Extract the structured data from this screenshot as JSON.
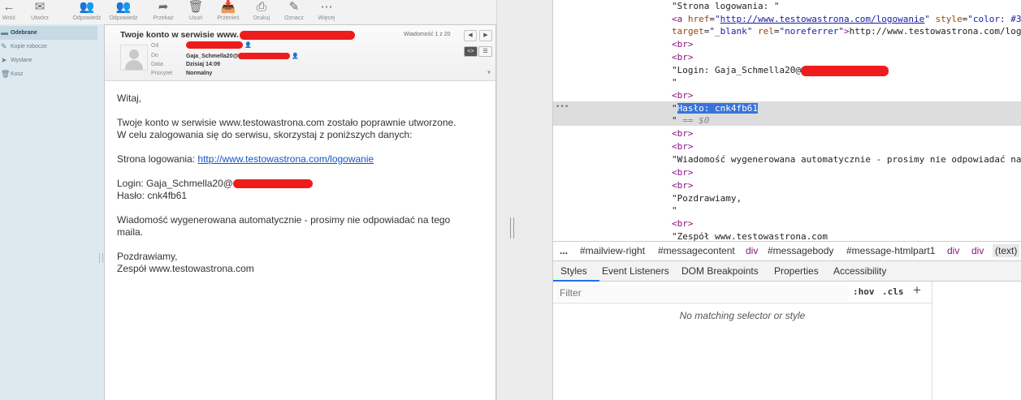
{
  "toolbar": {
    "buttons": [
      {
        "label": "Wróć",
        "icon": "back-arrow-icon"
      },
      {
        "label": "Utwórz",
        "icon": "compose-icon"
      },
      {
        "label": "Odpowiedz",
        "icon": "reply-icon"
      },
      {
        "label": "Odpowiedz",
        "icon": "reply-all-icon"
      },
      {
        "label": "Przekaż",
        "icon": "forward-icon"
      },
      {
        "label": "Usuń",
        "icon": "delete-icon"
      },
      {
        "label": "Przenieś",
        "icon": "move-icon"
      },
      {
        "label": "Drukuj",
        "icon": "print-icon"
      },
      {
        "label": "Oznacz",
        "icon": "mark-icon"
      },
      {
        "label": "Więcej",
        "icon": "more-icon"
      }
    ]
  },
  "folders": [
    {
      "label": "Odebrane",
      "active": true
    },
    {
      "label": "Kopie robocze",
      "active": false
    },
    {
      "label": "Wysłane",
      "active": false
    },
    {
      "label": "Kosz",
      "active": false
    }
  ],
  "message": {
    "subject": "Twoje konto w serwisie www.",
    "counter": "Wiadomość 1 z 20",
    "headers": {
      "from_label": "Od",
      "to_label": "Do",
      "to_value": "Gaja_Schmella20@",
      "date_label": "Data",
      "date_value": "Dzisiaj 14:09",
      "priority_label": "Priorytet",
      "priority_value": "Normalny"
    },
    "body": {
      "greeting": "Witaj,",
      "line1": "Twoje konto w serwisie www.testowastrona.com zostało poprawnie utworzone.",
      "line2": "W celu zalogowania się do serwisu, skorzystaj z poniższych danych:",
      "login_page_label": "Strona logowania:",
      "login_page_url": "http://www.testowastrona.com/logowanie",
      "login_label": "Login: Gaja_Schmella20@",
      "password_line": "Hasło: cnk4fb61",
      "auto_line1": "Wiadomość wygenerowana automatycznie - prosimy nie odpowiadać na tego",
      "auto_line2": "maila.",
      "regards": "Pozdrawiamy,",
      "team": "Zespół www.testowastrona.com"
    }
  },
  "devtools": {
    "dom": {
      "line_strona": "\"Strona logowania: \"",
      "a_open": "<a",
      "a_href_attr": "href",
      "a_href_val": "http://www.testowastrona.com/logowanie",
      "a_style_attr": "style",
      "a_style_val": "\"color: #3",
      "a_target_attr": "target",
      "a_target_val": "\"_blank\"",
      "a_rel_attr": "rel",
      "a_rel_val": "\"noreferrer\"",
      "a_text": "http://www.testowastrona.com/log",
      "br": "<br>",
      "login_text": "\"Login: Gaja_Schmella20@",
      "quote": "\"",
      "selected_text": "Hasło: cnk4fb61",
      "eq_dollar": "== $0",
      "auto_text": "\"Wiadomość wygenerowana automatycznie - prosimy nie odpowiadać na",
      "regards_text": "\"Pozdrawiamy,",
      "team_text": "\"Zespół www.testowastrona.com"
    },
    "breadcrumbs": [
      "...",
      "#mailview-right",
      "#messagecontent",
      "div",
      "#messagebody",
      "#message-htmlpart1",
      "div",
      "div",
      "(text)"
    ],
    "tabs": [
      "Styles",
      "Event Listeners",
      "DOM Breakpoints",
      "Properties",
      "Accessibility"
    ],
    "filter_placeholder": "Filter",
    "hov": ":hov",
    "cls": ".cls",
    "plus": "+",
    "no_match": "No matching selector or style"
  },
  "colors": {
    "redaction": "#ee1c1c",
    "selection": "#3874d8",
    "link": "#1155cc",
    "tag": "#881280"
  }
}
